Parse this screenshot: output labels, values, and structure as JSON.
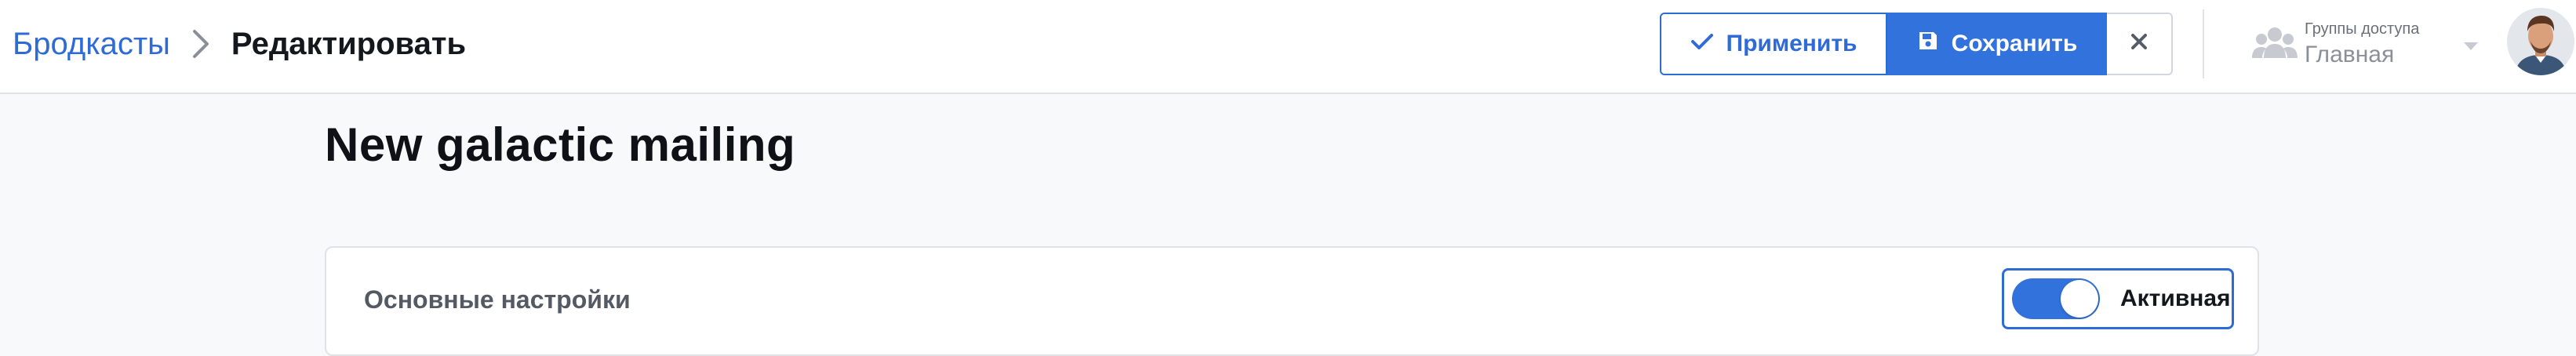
{
  "breadcrumb": {
    "parent": "Бродкасты",
    "current": "Редактировать"
  },
  "toolbar": {
    "apply_label": "Применить",
    "save_label": "Сохранить"
  },
  "access_groups": {
    "caption": "Группы доступа",
    "value": "Главная"
  },
  "page": {
    "title": "New galactic mailing"
  },
  "settings_card": {
    "title": "Основные настройки",
    "active_toggle": {
      "label": "Активная",
      "on": true
    }
  },
  "colors": {
    "accent": "#3272dc",
    "link": "#2f6bd6"
  },
  "icons": {
    "breadcrumb_separator": "chevron-right-icon",
    "apply": "check-icon",
    "save": "floppy-disk-icon",
    "close": "close-icon",
    "groups": "users-group-icon",
    "groups_dropdown": "caret-down-icon"
  }
}
